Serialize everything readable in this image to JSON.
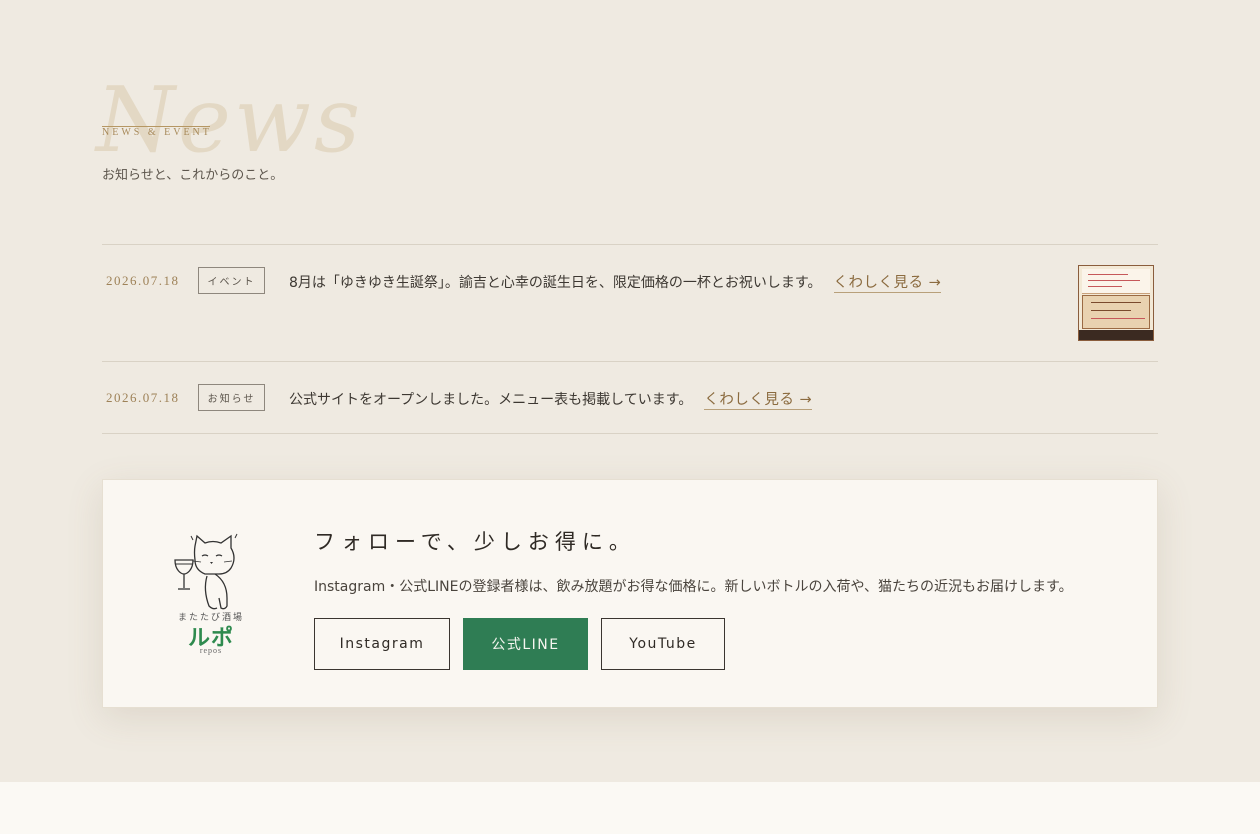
{
  "header": {
    "big_word": "News",
    "eyebrow": "NEWS & EVENT",
    "subtitle": "お知らせと、これからのこと。"
  },
  "news": [
    {
      "date": "2026.07.18",
      "tag": "イベント",
      "text": "8月は「ゆきゆき生誕祭」。諭吉と心幸の誕生日を、限定価格の一杯とお祝いします。",
      "more": "くわしく見る →",
      "has_thumbnail": true
    },
    {
      "date": "2026.07.18",
      "tag": "お知らせ",
      "text": "公式サイトをオープンしました。メニュー表も掲載しています。",
      "more": "くわしく見る →",
      "has_thumbnail": false
    }
  ],
  "follow": {
    "logo_sub": "またたび酒場",
    "logo_main": "ルポ",
    "logo_tiny": "repos",
    "title": "フォローで、少しお得に。",
    "description": "Instagram・公式LINEの登録者様は、飲み放題がお得な価格に。新しいボトルの入荷や、猫たちの近況もお届けします。",
    "buttons": {
      "instagram": "Instagram",
      "line": "公式LINE",
      "youtube": "YouTube"
    }
  },
  "colors": {
    "background": "#efeae1",
    "accent_gold": "#9e8258",
    "line_green": "#2f7d54",
    "card": "#faf7f2"
  }
}
